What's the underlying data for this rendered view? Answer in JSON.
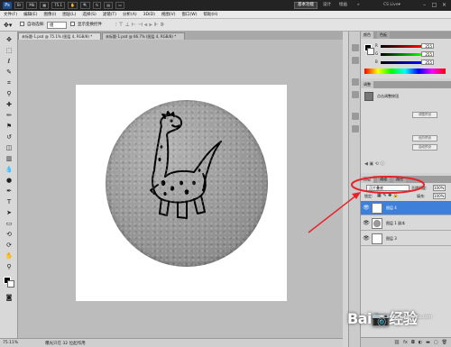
{
  "titlebar": {
    "ps_logo": "Ps",
    "zoom": "75.1",
    "workspace_essentials": "基本功能",
    "workspace_design": "设计",
    "workspace_painting": "绘画",
    "cslive": "CS Live▾"
  },
  "menu": [
    "文件(F)",
    "编辑(E)",
    "图像(I)",
    "图层(L)",
    "选择(S)",
    "滤镜(T)",
    "分析(A)",
    "3D(D)",
    "视图(V)",
    "窗口(W)",
    "帮助(H)"
  ],
  "options": {
    "auto_select_label": "自动选择:",
    "auto_select_value": "组",
    "show_transform": "显示变换控件"
  },
  "tabs": [
    "未标题-1.psd @ 75.1% (图层 4, RGB/8) *",
    "未标题-1.psd @ 66.7% (图层 4, RGB/8) *"
  ],
  "status": {
    "zoom": "75.11%",
    "doc": "曝光只在 32 位起作用"
  },
  "color_panel": {
    "tab1": "颜色",
    "tab2": "色板",
    "r_label": "R",
    "g_label": "G",
    "b_label": "B",
    "r": "255",
    "g": "255",
    "b": "255"
  },
  "adjust_panel": {
    "tab": "调整",
    "title": "点击调整按钮",
    "btn1": "调整预设",
    "btn2": "色阶预设",
    "btn3": "曲线预设"
  },
  "layers_panel": {
    "tab1": "图层",
    "tab2": "通道",
    "tab3": "路径",
    "blend_mode": "正片叠底",
    "opacity_label": "不透明度:",
    "opacity": "100%",
    "lock_label": "锁定:",
    "fill_label": "填充:",
    "fill": "100%",
    "layers": [
      {
        "name": "图层 4",
        "selected": true
      },
      {
        "name": "图层 1 副本",
        "selected": false
      },
      {
        "name": "图层 3",
        "selected": false
      }
    ]
  },
  "watermark": {
    "brand": "Bai📷经验",
    "url": "jingyan.baidu.com"
  },
  "colors": {
    "annotation_red": "#e8222a",
    "selected_layer": "#3e7fd9"
  }
}
